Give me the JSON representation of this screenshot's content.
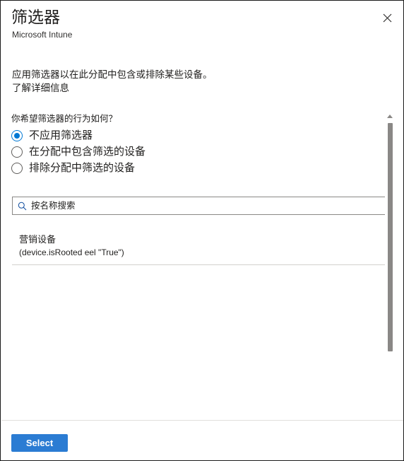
{
  "dialog": {
    "title": "筛选器",
    "subtitle": "Microsoft Intune",
    "close_icon": "close-icon"
  },
  "description": {
    "text": "应用筛选器以在此分配中包含或排除某些设备。",
    "link_label": "了解详细信息"
  },
  "form": {
    "question": "你希望筛选器的行为如何？",
    "options": [
      {
        "label": "不应用筛选器",
        "selected": true
      },
      {
        "label": "在分配中包含筛选的设备",
        "selected": false
      },
      {
        "label": "排除分配中筛选的设备",
        "selected": false
      }
    ]
  },
  "search": {
    "placeholder": "按名称搜索",
    "value": "",
    "icon": "search-icon"
  },
  "list": {
    "items": [
      {
        "name": "营销设备",
        "rule": "(device.isRooted eel \"True\")"
      }
    ]
  },
  "scrollbar": {
    "arrow_up_icon": "chevron-up-icon"
  },
  "footer": {
    "select_label": "Select"
  },
  "colors": {
    "accent": "#0078d4",
    "primary_button": "#2b7cd3",
    "text": "#201f1e",
    "border": "#8a8886",
    "divider": "#d2d0ce"
  }
}
